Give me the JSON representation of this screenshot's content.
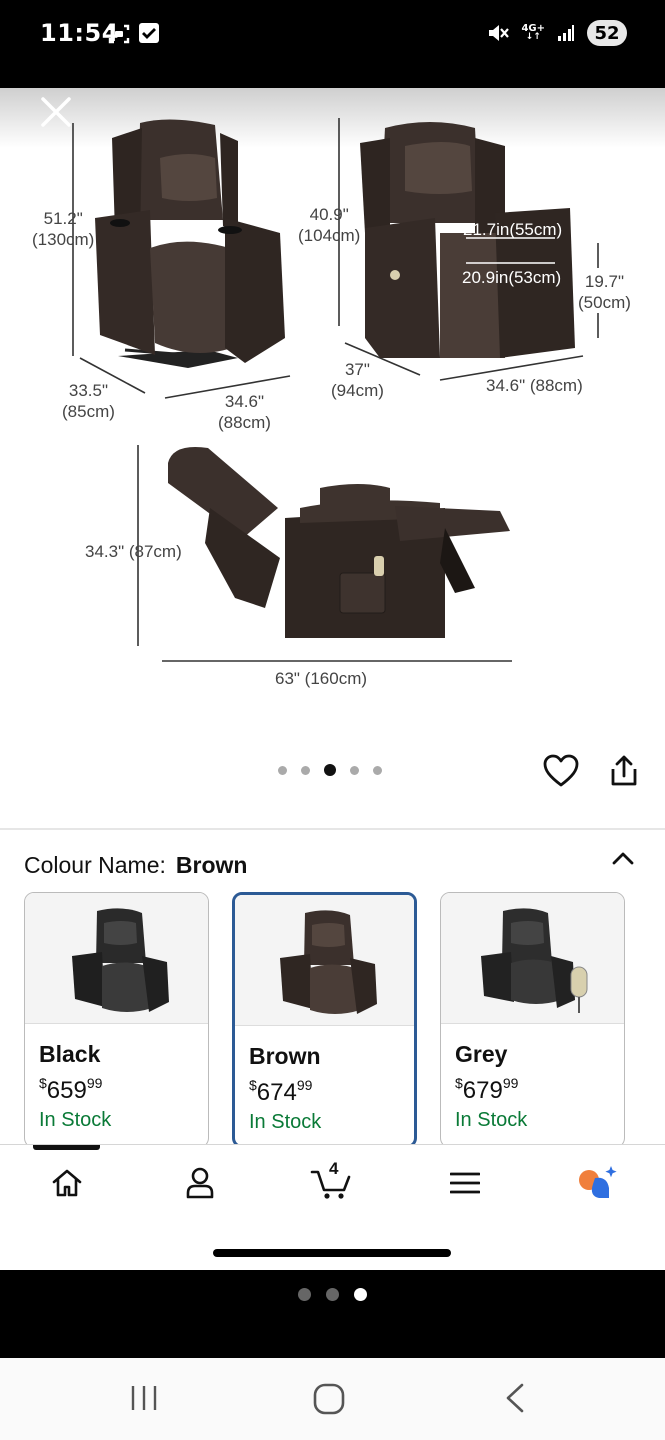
{
  "status_bar": {
    "time": "11:54",
    "network": "4G+",
    "battery": "52"
  },
  "product_image": {
    "dimensions": {
      "front_height": "51.2\"",
      "front_height_cm": "(130cm)",
      "front_depth": "33.5\"",
      "front_depth_cm": "(85cm)",
      "front_width": "34.6\"",
      "front_width_cm": "(88cm)",
      "side_height": "40.9\"",
      "side_height_cm": "(104cm)",
      "seat_width": "21.7in(55cm)",
      "seat_depth": "20.9in(53cm)",
      "seat_height": "19.7\"",
      "seat_height_cm": "(50cm)",
      "side_depth": "37\"",
      "side_depth_cm": "(94cm)",
      "side_width": "34.6\" (88cm)",
      "reclined_height": "34.3\" (87cm)",
      "reclined_length": "63\" (160cm)"
    },
    "carousel": {
      "total": 5,
      "active_index": 2
    }
  },
  "options": {
    "colour_label": "Colour Name:",
    "colour_value": "Brown",
    "variants": [
      {
        "name": "Black",
        "currency": "$",
        "price_whole": "659",
        "price_fraction": "99",
        "stock": "In Stock",
        "selected": false
      },
      {
        "name": "Brown",
        "currency": "$",
        "price_whole": "674",
        "price_fraction": "99",
        "stock": "In Stock",
        "selected": true
      },
      {
        "name": "Grey",
        "currency": "$",
        "price_whole": "679",
        "price_fraction": "99",
        "stock": "In Stock",
        "selected": false
      }
    ]
  },
  "bottom_nav": {
    "items": [
      "home-icon",
      "account-icon",
      "cart-icon",
      "menu-icon",
      "assistant-icon"
    ],
    "cart_count": "4"
  },
  "pager": {
    "total": 3,
    "active_index": 2
  },
  "colors": {
    "in_stock": "#0a7a37",
    "selected_border": "#2c5a95",
    "chair": "#3b302c"
  }
}
